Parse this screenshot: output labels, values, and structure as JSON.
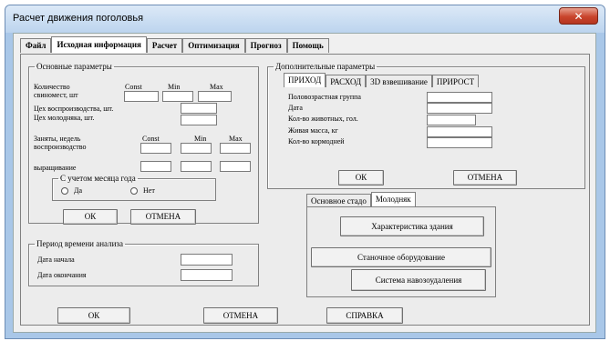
{
  "window": {
    "title": "Расчет движения поголовья",
    "close_label": "✕"
  },
  "main_tabs": [
    "Файл",
    "Исходная информация",
    "Расчет",
    "Оптимизация",
    "Прогноз",
    "Помощь"
  ],
  "basic": {
    "legend": "Основные параметры",
    "headers": {
      "const": "Const",
      "min": "Min",
      "max": "Max"
    },
    "count_label_1": "Количество",
    "count_label_2": "свиномест, шт",
    "shop_repro": "Цех воспроизводства, шт.",
    "shop_young": "Цех молодняка, шт.",
    "weeks_1": "Заняты, недель",
    "weeks_2": "воспроизводство",
    "raising": "выращивание",
    "month_group": {
      "legend": "С учетом месяца года",
      "yes": "Да",
      "no": "Нет"
    },
    "ok": "ОК",
    "cancel": "ОТМЕНА"
  },
  "period": {
    "legend": "Период времени анализа",
    "start": "Дата начала",
    "end": "Дата окончания"
  },
  "extra": {
    "legend": "Дополнительные параметры",
    "tabs": [
      "ПРИХОД",
      "РАСХОД",
      "3D взвешивание",
      "ПРИРОСТ"
    ],
    "fields": [
      "Половозрастная группа",
      "Дата",
      "Кол-во животных, гол.",
      "Живая масса, кг",
      "Кол-во кормодней"
    ],
    "ok": "ОК",
    "cancel": "ОТМЕНА"
  },
  "herd": {
    "tabs": [
      "Основное стадо",
      "Молодняк"
    ],
    "buttons": [
      "Характеристика здания",
      "Станочное оборудование",
      "Система навозоудаления"
    ]
  },
  "footer": {
    "ok": "ОК",
    "cancel": "ОТМЕНА",
    "help": "СПРАВКА"
  }
}
